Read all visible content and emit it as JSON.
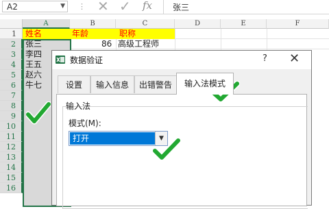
{
  "formula_bar": {
    "name_box": "A2",
    "name_box_arrow": "▼",
    "separator": "⋮",
    "cancel_icon": "✕",
    "enter_icon": "✓",
    "fx": "fx",
    "content": "张三"
  },
  "columns": [
    "A",
    "B",
    "C",
    "D",
    "E",
    "F"
  ],
  "rows": [
    "1",
    "2",
    "3",
    "4",
    "5",
    "6",
    "7",
    "8",
    "9",
    "10",
    "11",
    "12",
    "13",
    "14",
    "15",
    "16"
  ],
  "sheet": {
    "header_row": {
      "a": "姓名",
      "b": "年龄",
      "c": "职称"
    },
    "row2": {
      "b": "86",
      "c": "高级工程师"
    },
    "names": [
      "张三",
      "李四",
      "王五",
      "赵六",
      "牛七"
    ],
    "header_text_color": "#ff0000",
    "highlight_color": "#ffff00"
  },
  "dialog": {
    "title": "数据验证",
    "help": "?",
    "close": "✕",
    "tabs": [
      "设置",
      "输入信息",
      "出错警告",
      "输入法模式"
    ],
    "active_tab": "输入法模式",
    "group_title": "输入法",
    "mode_label": "模式(M):",
    "mode_value": "打开",
    "dropdown_arrow": "▼"
  },
  "annotations": {
    "checkmark_color": "#22a832"
  }
}
